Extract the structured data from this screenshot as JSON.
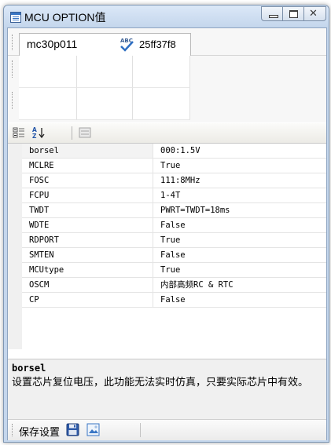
{
  "window": {
    "title": "MCU OPTION值"
  },
  "tab": {
    "label": "mc30p011",
    "id_value": "25ff37f8"
  },
  "toolbar": {
    "categorized_icon": "categorized-icon",
    "alphabetical_icon": "sort-alpha-icon",
    "property_pages_icon": "property-pages-icon"
  },
  "properties": [
    {
      "name": "borsel",
      "value": "000:1.5V"
    },
    {
      "name": "MCLRE",
      "value": "True"
    },
    {
      "name": "FOSC",
      "value": "111:8MHz"
    },
    {
      "name": "FCPU",
      "value": "1-4T"
    },
    {
      "name": "TWDT",
      "value": "PWRT=TWDT=18ms"
    },
    {
      "name": "WDTE",
      "value": "False"
    },
    {
      "name": "RDPORT",
      "value": "True"
    },
    {
      "name": "SMTEN",
      "value": "False"
    },
    {
      "name": "MCUtype",
      "value": "True"
    },
    {
      "name": "OSCM",
      "value": "内部高频RC & RTC"
    },
    {
      "name": "CP",
      "value": "False"
    }
  ],
  "description": {
    "title": "borsel",
    "text": "设置芯片复位电压，此功能无法实时仿真，只要实际芯片中有效。"
  },
  "bottom": {
    "save_label": "保存设置",
    "save_icon": "floppy-disk-icon",
    "image_icon": "image-icon"
  },
  "colors": {
    "titlebar": "#c4d6ec",
    "selected_row": "#f3f3f3",
    "grid_margin": "#f0f0f0"
  }
}
